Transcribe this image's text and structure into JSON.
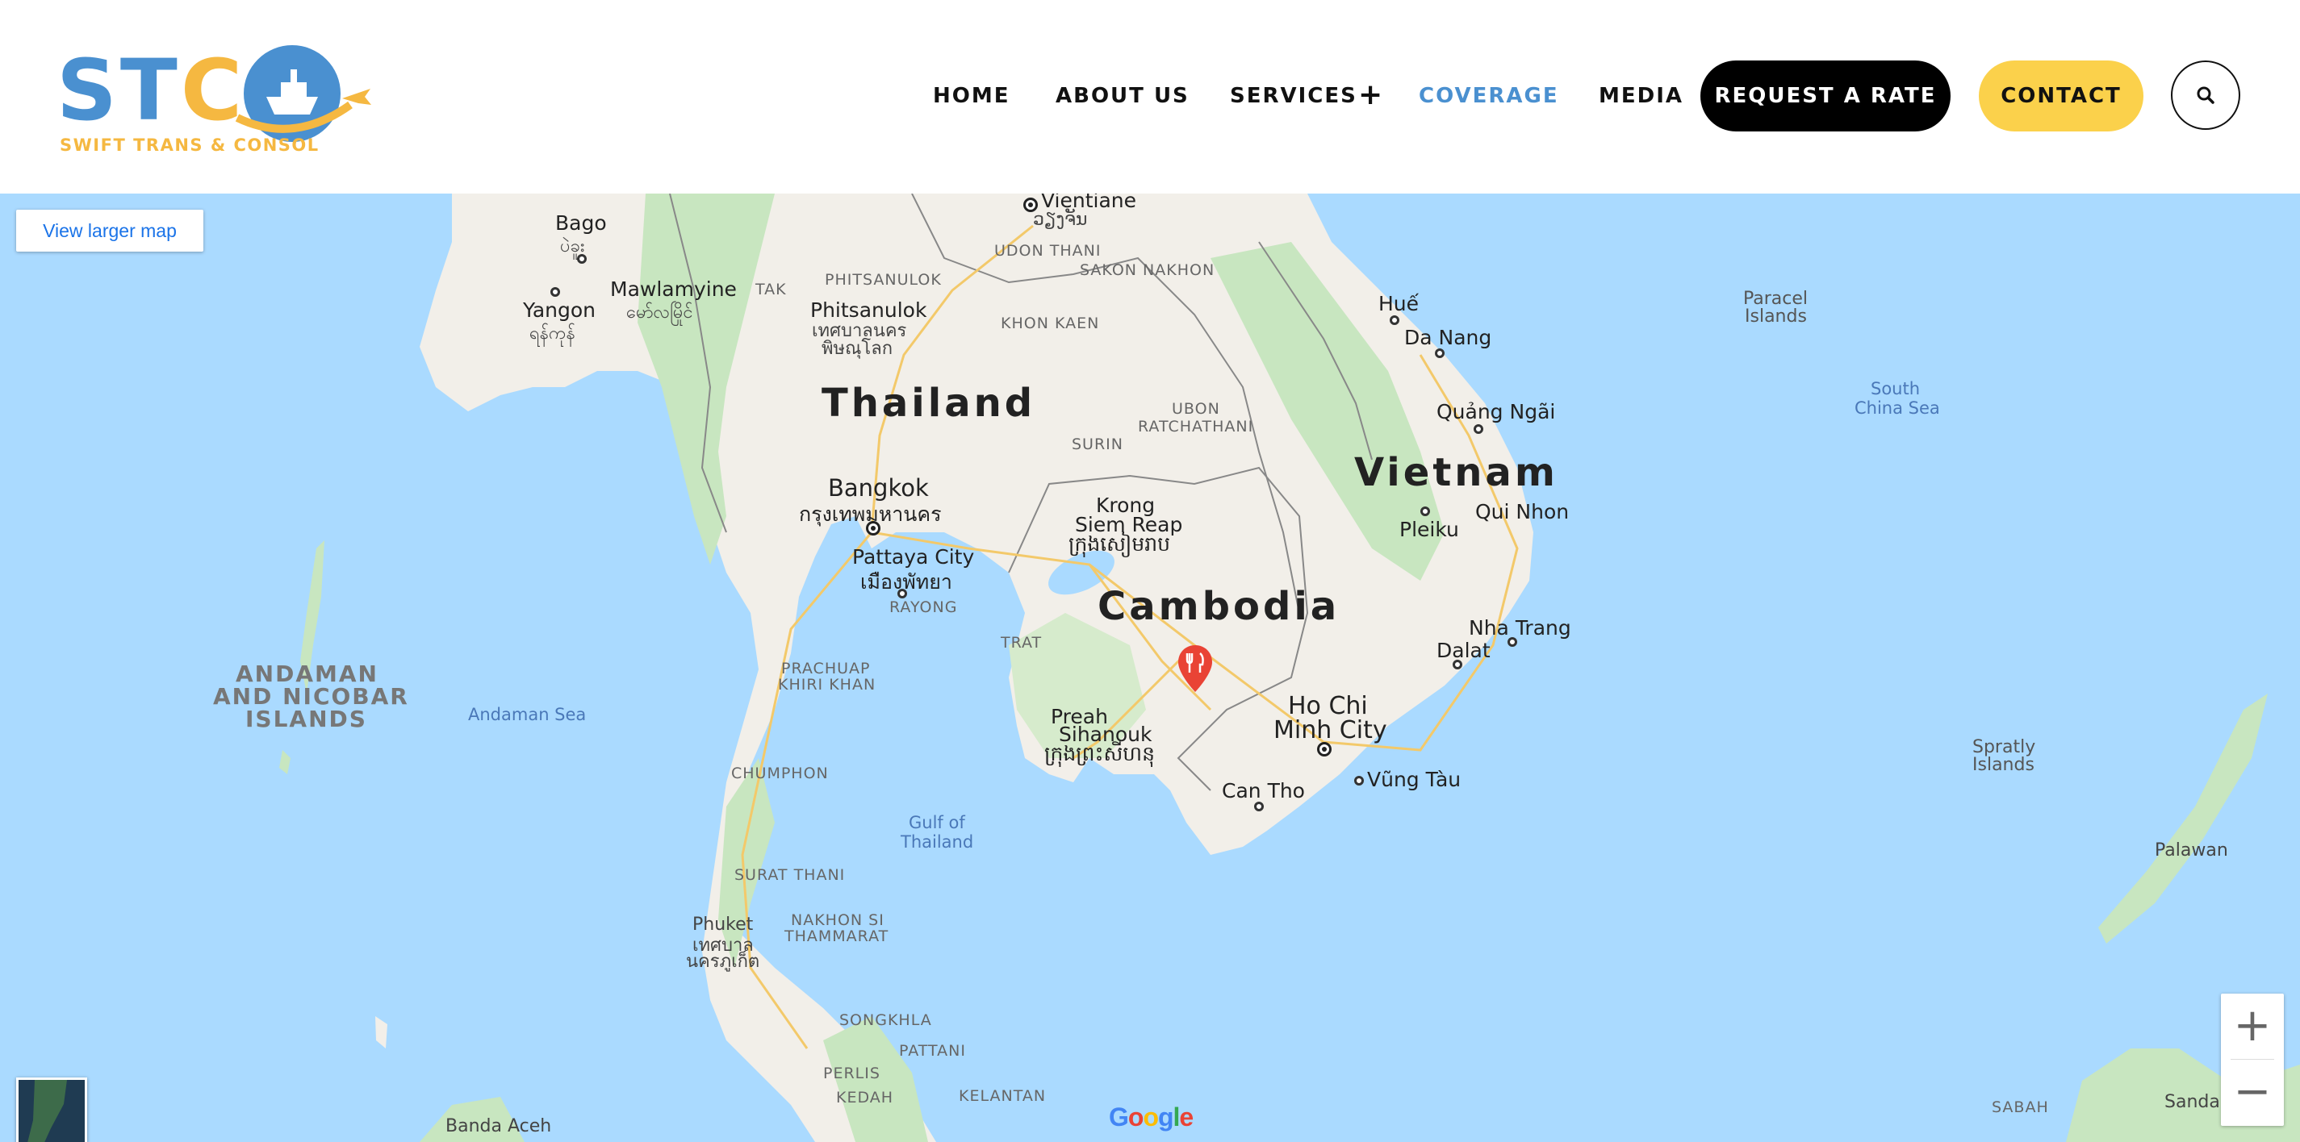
{
  "header": {
    "logo": {
      "letters": [
        "S",
        "T",
        "C"
      ],
      "tagline": "SWIFT TRANS & CONSOL"
    },
    "nav": [
      {
        "label": "HOME"
      },
      {
        "label": "ABOUT US"
      },
      {
        "label": "SERVICES",
        "expand_symbol": "+"
      },
      {
        "label": "COVERAGE",
        "active": true
      },
      {
        "label": "MEDIA"
      }
    ],
    "request_button": "REQUEST A RATE",
    "contact_button": "CONTACT",
    "search_icon": "search-icon",
    "colors": {
      "brand_blue": "#4a90d0",
      "brand_yellow": "#f5b841",
      "pill_yellow": "#fbd14b",
      "active_nav": "#4a90d0"
    }
  },
  "map": {
    "view_larger": "View larger map",
    "zoom_in": "+",
    "zoom_out": "−",
    "attribution": "Google",
    "marker_icon": "restaurant-marker-icon",
    "colors": {
      "water": "#aadaff",
      "land": "#f2efe9",
      "forest": "#c8e6c0"
    },
    "countries": {
      "thailand": "Thailand",
      "vietnam": "Vietnam",
      "cambodia": "Cambodia"
    },
    "cities": {
      "bago": "Bago",
      "bago_local": "ပဲခူး",
      "mawlamyine": "Mawlamyine",
      "mawlamyine_local": "မော်လမြိုင်",
      "yangon": "Yangon",
      "yangon_local": "ရန်ကုန်",
      "vientiane": "Vientiane",
      "vientiane_local": "ວຽງຈັນ",
      "phitsanulok": "Phitsanulok",
      "phitsanulok_local1": "เทศบาลนคร",
      "phitsanulok_local2": "พิษณุโลก",
      "bangkok": "Bangkok",
      "bangkok_local": "กรุงเทพมหานคร",
      "pattaya": "Pattaya City",
      "pattaya_local": "เมืองพัทยา",
      "krong": "Krong",
      "siem_reap": "Siem Reap",
      "siem_reap_local": "ក្រុងសៀមរាប",
      "hue": "Huế",
      "da_nang": "Da Nang",
      "quang_ngai": "Quảng Ngãi",
      "pleiku": "Pleiku",
      "qui_nhon": "Qui Nhon",
      "nha_trang": "Nha Trang",
      "dalat": "Dalat",
      "ho_chi": "Ho Chi",
      "minh_city": "Minh City",
      "vung_tau": "Vũng Tàu",
      "can_tho": "Can Tho",
      "preah": "Preah",
      "sihanouk": "Sihanouk",
      "sihanouk_local": "ក្រុងព្រះសីហនុ",
      "phuket": "Phuket",
      "phuket_local1": "เทศบาล",
      "phuket_local2": "นครภูเก็ต",
      "banda_aceh": "Banda Aceh",
      "sandakan": "Sandakan",
      "palawan": "Palawan"
    },
    "regions": {
      "tak": "TAK",
      "phitsanulok_prov": "PHITSANULOK",
      "udon_thani": "UDON THANI",
      "sakon_nakhon": "SAKON NAKHON",
      "khon_kaen": "KHON KAEN",
      "ubon": "UBON",
      "ratchathani": "RATCHATHANI",
      "surin": "SURIN",
      "rayong": "RAYONG",
      "trat": "TRAT",
      "prachuap": "PRACHUAP",
      "khiri_khan": "KHIRI KHAN",
      "chumphon": "CHUMPHON",
      "surat_thani": "SURAT THANI",
      "nakhon_si": "NAKHON SI",
      "thammarat": "THAMMARAT",
      "songkhla": "SONGKHLA",
      "pattani": "PATTANI",
      "perlis": "PERLIS",
      "kedah": "KEDAH",
      "kelantan": "KELANTAN",
      "sabah": "SABAH"
    },
    "seas": {
      "andaman": "Andaman Sea",
      "gulf_1": "Gulf of",
      "gulf_2": "Thailand",
      "scs_1": "South",
      "scs_2": "China Sea"
    },
    "islands": {
      "andaman_1": "ANDAMAN",
      "andaman_2": "AND NICOBAR",
      "andaman_3": "ISLANDS",
      "paracel_1": "Paracel",
      "paracel_2": "Islands",
      "spratly_1": "Spratly",
      "spratly_2": "Islands"
    }
  }
}
